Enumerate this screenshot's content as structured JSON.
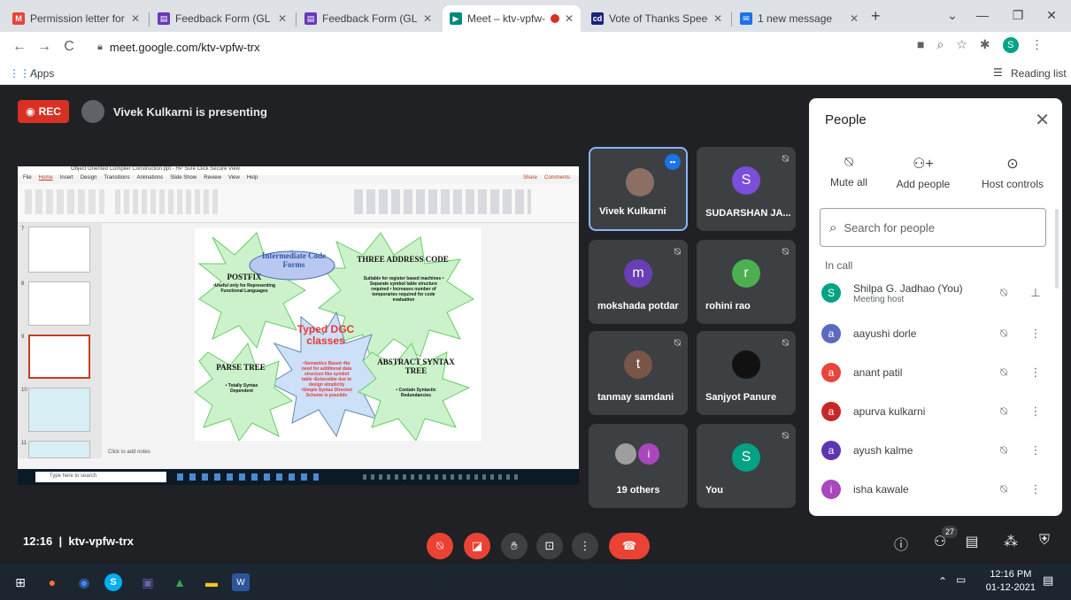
{
  "browser": {
    "tabs": [
      {
        "label": "Permission letter for G",
        "color": "#ea4335",
        "glyph": "M"
      },
      {
        "label": "Feedback Form (GL on",
        "color": "#673ab7",
        "glyph": "▤"
      },
      {
        "label": "Feedback Form (GL on",
        "color": "#673ab7",
        "glyph": "▤"
      },
      {
        "label": "Meet – ktv-vpfw-",
        "color": "#00897b",
        "glyph": "▶"
      },
      {
        "label": "Vote of Thanks Speec",
        "color": "#1a237e",
        "glyph": "cd"
      },
      {
        "label": "1 new message",
        "color": "#1a73e8",
        "glyph": "✉"
      }
    ],
    "url": "meet.google.com/ktv-vpfw-trx",
    "bookmarks_apps": "Apps",
    "reading_list": "Reading list"
  },
  "meet": {
    "rec_label": "REC",
    "presenting_text": "Vivek Kulkarni is presenting",
    "tiles": [
      {
        "name": "Vivek Kulkarni",
        "initial": "",
        "color": "#8d6e63"
      },
      {
        "name": "SUDARSHAN JA...",
        "initial": "S",
        "color": "#7b4fd9"
      },
      {
        "name": "mokshada potdar",
        "initial": "m",
        "color": "#6a3fb5"
      },
      {
        "name": "rohini rao",
        "initial": "r",
        "color": "#4caf50"
      },
      {
        "name": "tanmay samdani",
        "initial": "t",
        "color": "#795548"
      },
      {
        "name": "Sanjyot Panure",
        "initial": "",
        "color": "#111111"
      },
      {
        "name": "19 others",
        "initial": "i",
        "color": "#ab47bc"
      },
      {
        "name": "You",
        "initial": "S",
        "color": "#00a383"
      }
    ],
    "meeting_time": "12:16",
    "meeting_code": "ktv-vpfw-trx",
    "participants_count": "27"
  },
  "slide": {
    "app_title": "Object Oriented Compiler Construction.ppt - HP Sure Click Secure View",
    "ribbon_tabs": [
      "File",
      "Home",
      "Insert",
      "Design",
      "Transitions",
      "Animations",
      "Slide Show",
      "Review",
      "View",
      "Help"
    ],
    "share": "Share",
    "comments": "Comments",
    "header": "Intermediate Code Forms",
    "postfix_title": "POSTFIX",
    "postfix_desc": "•Useful only for Representing Functional Languages",
    "tac_title": "THREE ADDRESS CODE",
    "tac_desc": "Suitable for register based machines • Separate symbol table structure required • Increases number of temporaries required for code evaluation",
    "typed_title": "Typed DGC classes",
    "typed_desc": "•Semantics Based •No need for additional data structure like symbol table •Extensible due to design simplicity •Simple Syntax Directed Scheme is possible",
    "parse_title": "PARSE TREE",
    "parse_desc": "• Totally Syntax Dependent",
    "ast_title": "ABSTRACT SYNTAX TREE",
    "ast_desc": "• Contain Syntactic Redundancies",
    "notes": "Click to add notes",
    "search": "Type here to search",
    "thumb_nums": [
      "7",
      "8",
      "9",
      "10",
      "11"
    ]
  },
  "people": {
    "title": "People",
    "mute_all": "Mute all",
    "add_people": "Add people",
    "host_controls": "Host controls",
    "search_placeholder": "Search for people",
    "in_call": "In call",
    "list": [
      {
        "name": "Shilpa G. Jadhao (You)",
        "sub": "Meeting host",
        "initial": "S",
        "color": "#00a383",
        "action": "pin"
      },
      {
        "name": "aayushi dorle",
        "sub": "",
        "initial": "a",
        "color": "#5c6bc0",
        "action": "more"
      },
      {
        "name": "anant patil",
        "sub": "",
        "initial": "a",
        "color": "#e8453c",
        "action": "more"
      },
      {
        "name": "apurva kulkarni",
        "sub": "",
        "initial": "a",
        "color": "#c62828",
        "action": "more"
      },
      {
        "name": "ayush kalme",
        "sub": "",
        "initial": "a",
        "color": "#5e35b1",
        "action": "more"
      },
      {
        "name": "isha kawale",
        "sub": "",
        "initial": "i",
        "color": "#ab47bc",
        "action": "more"
      }
    ]
  },
  "taskbar": {
    "time": "12:16 PM",
    "date": "01-12-2021"
  }
}
